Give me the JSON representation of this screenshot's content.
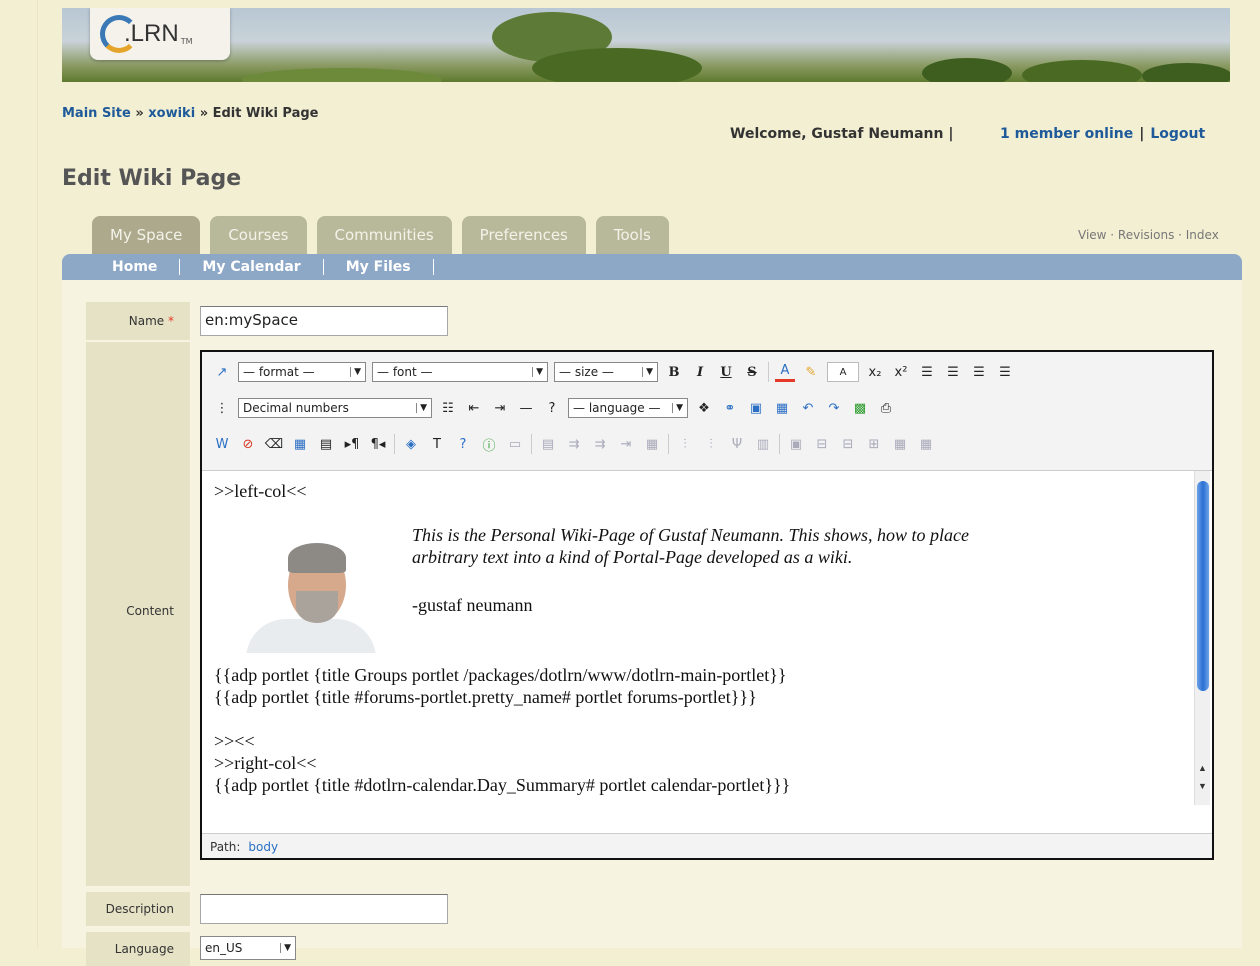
{
  "header": {
    "logo_text": ".LRN",
    "logo_tm": "TM"
  },
  "breadcrumb": {
    "items": [
      "Main Site",
      "xowiki",
      "Edit Wiki Page"
    ],
    "separator": "»"
  },
  "user": {
    "welcome": "Welcome, Gustaf Neumann |",
    "online": "1 member online",
    "logout": "Logout"
  },
  "page_title": "Edit Wiki Page",
  "tabs": [
    {
      "label": "My Space",
      "active": true
    },
    {
      "label": "Courses"
    },
    {
      "label": "Communities"
    },
    {
      "label": "Preferences"
    },
    {
      "label": "Tools"
    }
  ],
  "right_links": "View · Revisions · Index",
  "subnav": [
    "Home",
    "My Calendar",
    "My Files"
  ],
  "form": {
    "name_label": "Name",
    "required_mark": "*",
    "name_value": "en:mySpace",
    "content_label": "Content",
    "description_label": "Description",
    "description_value": "",
    "language_label": "Language",
    "language_value": "en_US"
  },
  "editor": {
    "format_select": "— format —",
    "font_select": "— font —",
    "size_select": "— size —",
    "list_select": "Decimal numbers",
    "language_select": "— language —",
    "path_label": "Path:",
    "path_value": "body",
    "lines": [
      ">>left-col<<",
      "This is the Personal Wiki-Page of Gustaf Neumann. This shows, how to place",
      "arbitrary text into a kind of Portal-Page developed as a wiki.",
      "-gustaf neumann",
      "{{adp portlet {title Groups portlet /packages/dotlrn/www/dotlrn-main-portlet}}",
      "{{adp portlet {title #forums-portlet.pretty_name# portlet forums-portlet}}}",
      ">><<",
      ">>right-col<<",
      "{{adp portlet {title #dotlrn-calendar.Day_Summary# portlet calendar-portlet}}}"
    ]
  },
  "colors": {
    "page_bg": "#f3efd3",
    "link": "#1e5a9a",
    "tab_bg": "#b8b89a",
    "subnav_bg": "#8da7c6",
    "required": "#e53a2a"
  }
}
